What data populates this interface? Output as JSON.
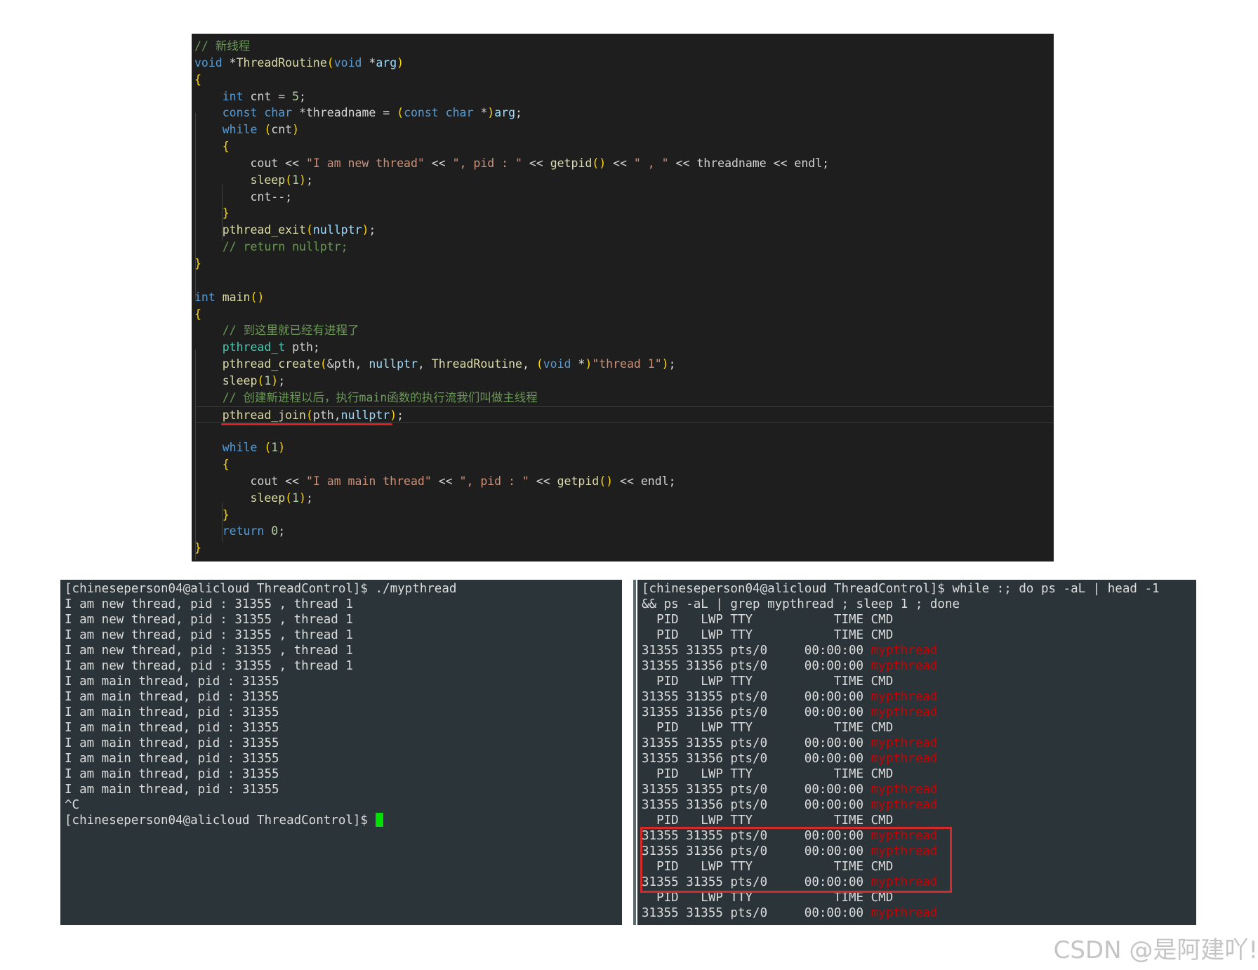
{
  "code_editor": {
    "lines": [
      "// 新线程",
      "void *ThreadRoutine(void *arg)",
      "{",
      "    int cnt = 5;",
      "    const char *threadname = (const char *)arg;",
      "    while (cnt)",
      "    {",
      "        cout << \"I am new thread\" << \", pid : \" << getpid() << \" , \" << threadname << endl;",
      "        sleep(1);",
      "        cnt--;",
      "    }",
      "    pthread_exit(nullptr);",
      "    // return nullptr;",
      "}",
      "",
      "int main()",
      "{",
      "    // 到这里就已经有进程了",
      "    pthread_t pth;",
      "    pthread_create(&pth, nullptr, ThreadRoutine, (void *)\"thread 1\");",
      "    sleep(1);",
      "    // 创建新进程以后，执行main函数的执行流我们叫做主线程",
      "    pthread_join(pth,nullptr);",
      "",
      "    while (1)",
      "    {",
      "        cout << \"I am main thread\" << \", pid : \" << getpid() << endl;",
      "        sleep(1);",
      "    }",
      "    return 0;",
      "}"
    ],
    "highlighted_line": 22
  },
  "terminal_left": {
    "prompt": "[chineseperson04@alicloud ThreadControl]$ ",
    "command": "./mypthread",
    "output": [
      "I am new thread, pid : 31355 , thread 1",
      "I am new thread, pid : 31355 , thread 1",
      "I am new thread, pid : 31355 , thread 1",
      "I am new thread, pid : 31355 , thread 1",
      "I am new thread, pid : 31355 , thread 1",
      "I am main thread, pid : 31355",
      "I am main thread, pid : 31355",
      "I am main thread, pid : 31355",
      "I am main thread, pid : 31355",
      "I am main thread, pid : 31355",
      "I am main thread, pid : 31355",
      "I am main thread, pid : 31355",
      "I am main thread, pid : 31355",
      "^C"
    ],
    "final_prompt": "[chineseperson04@alicloud ThreadControl]$ "
  },
  "terminal_right": {
    "prompt": "[chineseperson04@alicloud ThreadControl]$ ",
    "command_line1": "while :; do ps -aL | head -1",
    "command_line2": "&& ps -aL | grep mypthread ; sleep 1 ; done",
    "rows": [
      {
        "text": "  PID   LWP TTY           TIME ",
        "cmd": "CMD",
        "red": false
      },
      {
        "text": "  PID   LWP TTY           TIME ",
        "cmd": "CMD",
        "red": false
      },
      {
        "text": "31355 31355 pts/0     00:00:00 ",
        "cmd": "mypthread",
        "red": true
      },
      {
        "text": "31355 31356 pts/0     00:00:00 ",
        "cmd": "mypthread",
        "red": true
      },
      {
        "text": "  PID   LWP TTY           TIME ",
        "cmd": "CMD",
        "red": false
      },
      {
        "text": "31355 31355 pts/0     00:00:00 ",
        "cmd": "mypthread",
        "red": true
      },
      {
        "text": "31355 31356 pts/0     00:00:00 ",
        "cmd": "mypthread",
        "red": true
      },
      {
        "text": "  PID   LWP TTY           TIME ",
        "cmd": "CMD",
        "red": false
      },
      {
        "text": "31355 31355 pts/0     00:00:00 ",
        "cmd": "mypthread",
        "red": true
      },
      {
        "text": "31355 31356 pts/0     00:00:00 ",
        "cmd": "mypthread",
        "red": true
      },
      {
        "text": "  PID   LWP TTY           TIME ",
        "cmd": "CMD",
        "red": false
      },
      {
        "text": "31355 31355 pts/0     00:00:00 ",
        "cmd": "mypthread",
        "red": true
      },
      {
        "text": "31355 31356 pts/0     00:00:00 ",
        "cmd": "mypthread",
        "red": true
      },
      {
        "text": "  PID   LWP TTY           TIME ",
        "cmd": "CMD",
        "red": false
      },
      {
        "text": "31355 31355 pts/0     00:00:00 ",
        "cmd": "mypthread",
        "red": true
      },
      {
        "text": "31355 31356 pts/0     00:00:00 ",
        "cmd": "mypthread",
        "red": true
      },
      {
        "text": "  PID   LWP TTY           TIME ",
        "cmd": "CMD",
        "red": false
      },
      {
        "text": "31355 31355 pts/0     00:00:00 ",
        "cmd": "mypthread",
        "red": true
      },
      {
        "text": "  PID   LWP TTY           TIME ",
        "cmd": "CMD",
        "red": false
      },
      {
        "text": "31355 31355 pts/0     00:00:00 ",
        "cmd": "mypthread",
        "red": true
      }
    ]
  },
  "watermark": "CSDN @是阿建吖!",
  "colors": {
    "editor_bg": "#1e1e1e",
    "terminal_bg": "#2b3539",
    "process_name_red": "#cc0000",
    "annotation_red": "#d42a2a",
    "cursor_green": "#00e000"
  }
}
